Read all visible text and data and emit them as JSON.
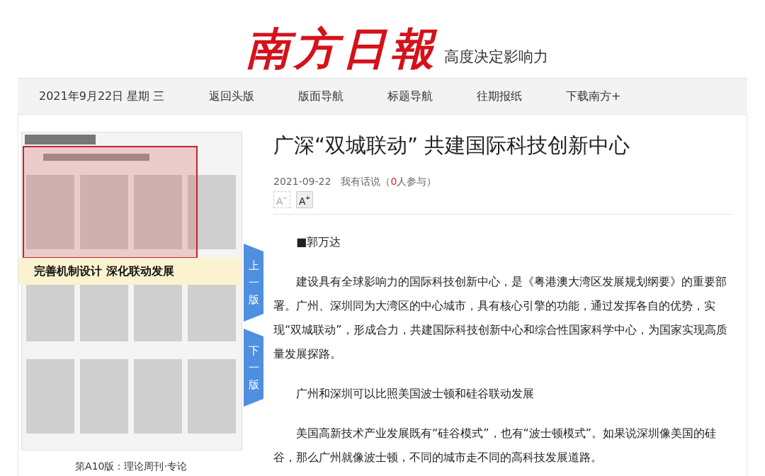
{
  "header": {
    "logo": "南方日報",
    "slogan": "高度决定影响力"
  },
  "nav": {
    "date": "2021年9月22日 星期 三",
    "links": [
      "返回头版",
      "版面导航",
      "标题导航",
      "往期报纸",
      "下载南方+"
    ]
  },
  "page_viewer": {
    "kind": "picture",
    "tooltip": "完善机制设计 深化联动发展",
    "prev": "上一版",
    "next": "下一版",
    "caption": "第A10版：理论周刊·专论"
  },
  "article": {
    "title": "广深“双城联动” 共建国际科技创新中心",
    "date": "2021-09-22",
    "comment_link": "我有话说",
    "participants_open": "（",
    "participants_count": "0",
    "participants_close": "人参与）",
    "font_buttons": [
      {
        "label": "A",
        "sup": "−",
        "disabled": true
      },
      {
        "label": "A",
        "sup": "+",
        "disabled": false
      }
    ],
    "paragraphs": [
      "■郭万达",
      "建设具有全球影响力的国际科技创新中心，是《粤港澳大湾区发展规划纲要》的重要部署。广州、深圳同为大湾区的中心城市，具有核心引擎的功能，通过发挥各自的优势，实现“双城联动”，形成合力，共建国际科技创新中心和综合性国家科学中心，为国家实现高质量发展探路。",
      "广州和深圳可以比照美国波士顿和硅谷联动发展",
      "美国高新技术产业发展既有“硅谷模式”，也有“波士顿模式”。如果说深圳像美国的硅谷，那么广州就像波士顿，不同的城市走不同的高科技发展道路。"
    ]
  }
}
